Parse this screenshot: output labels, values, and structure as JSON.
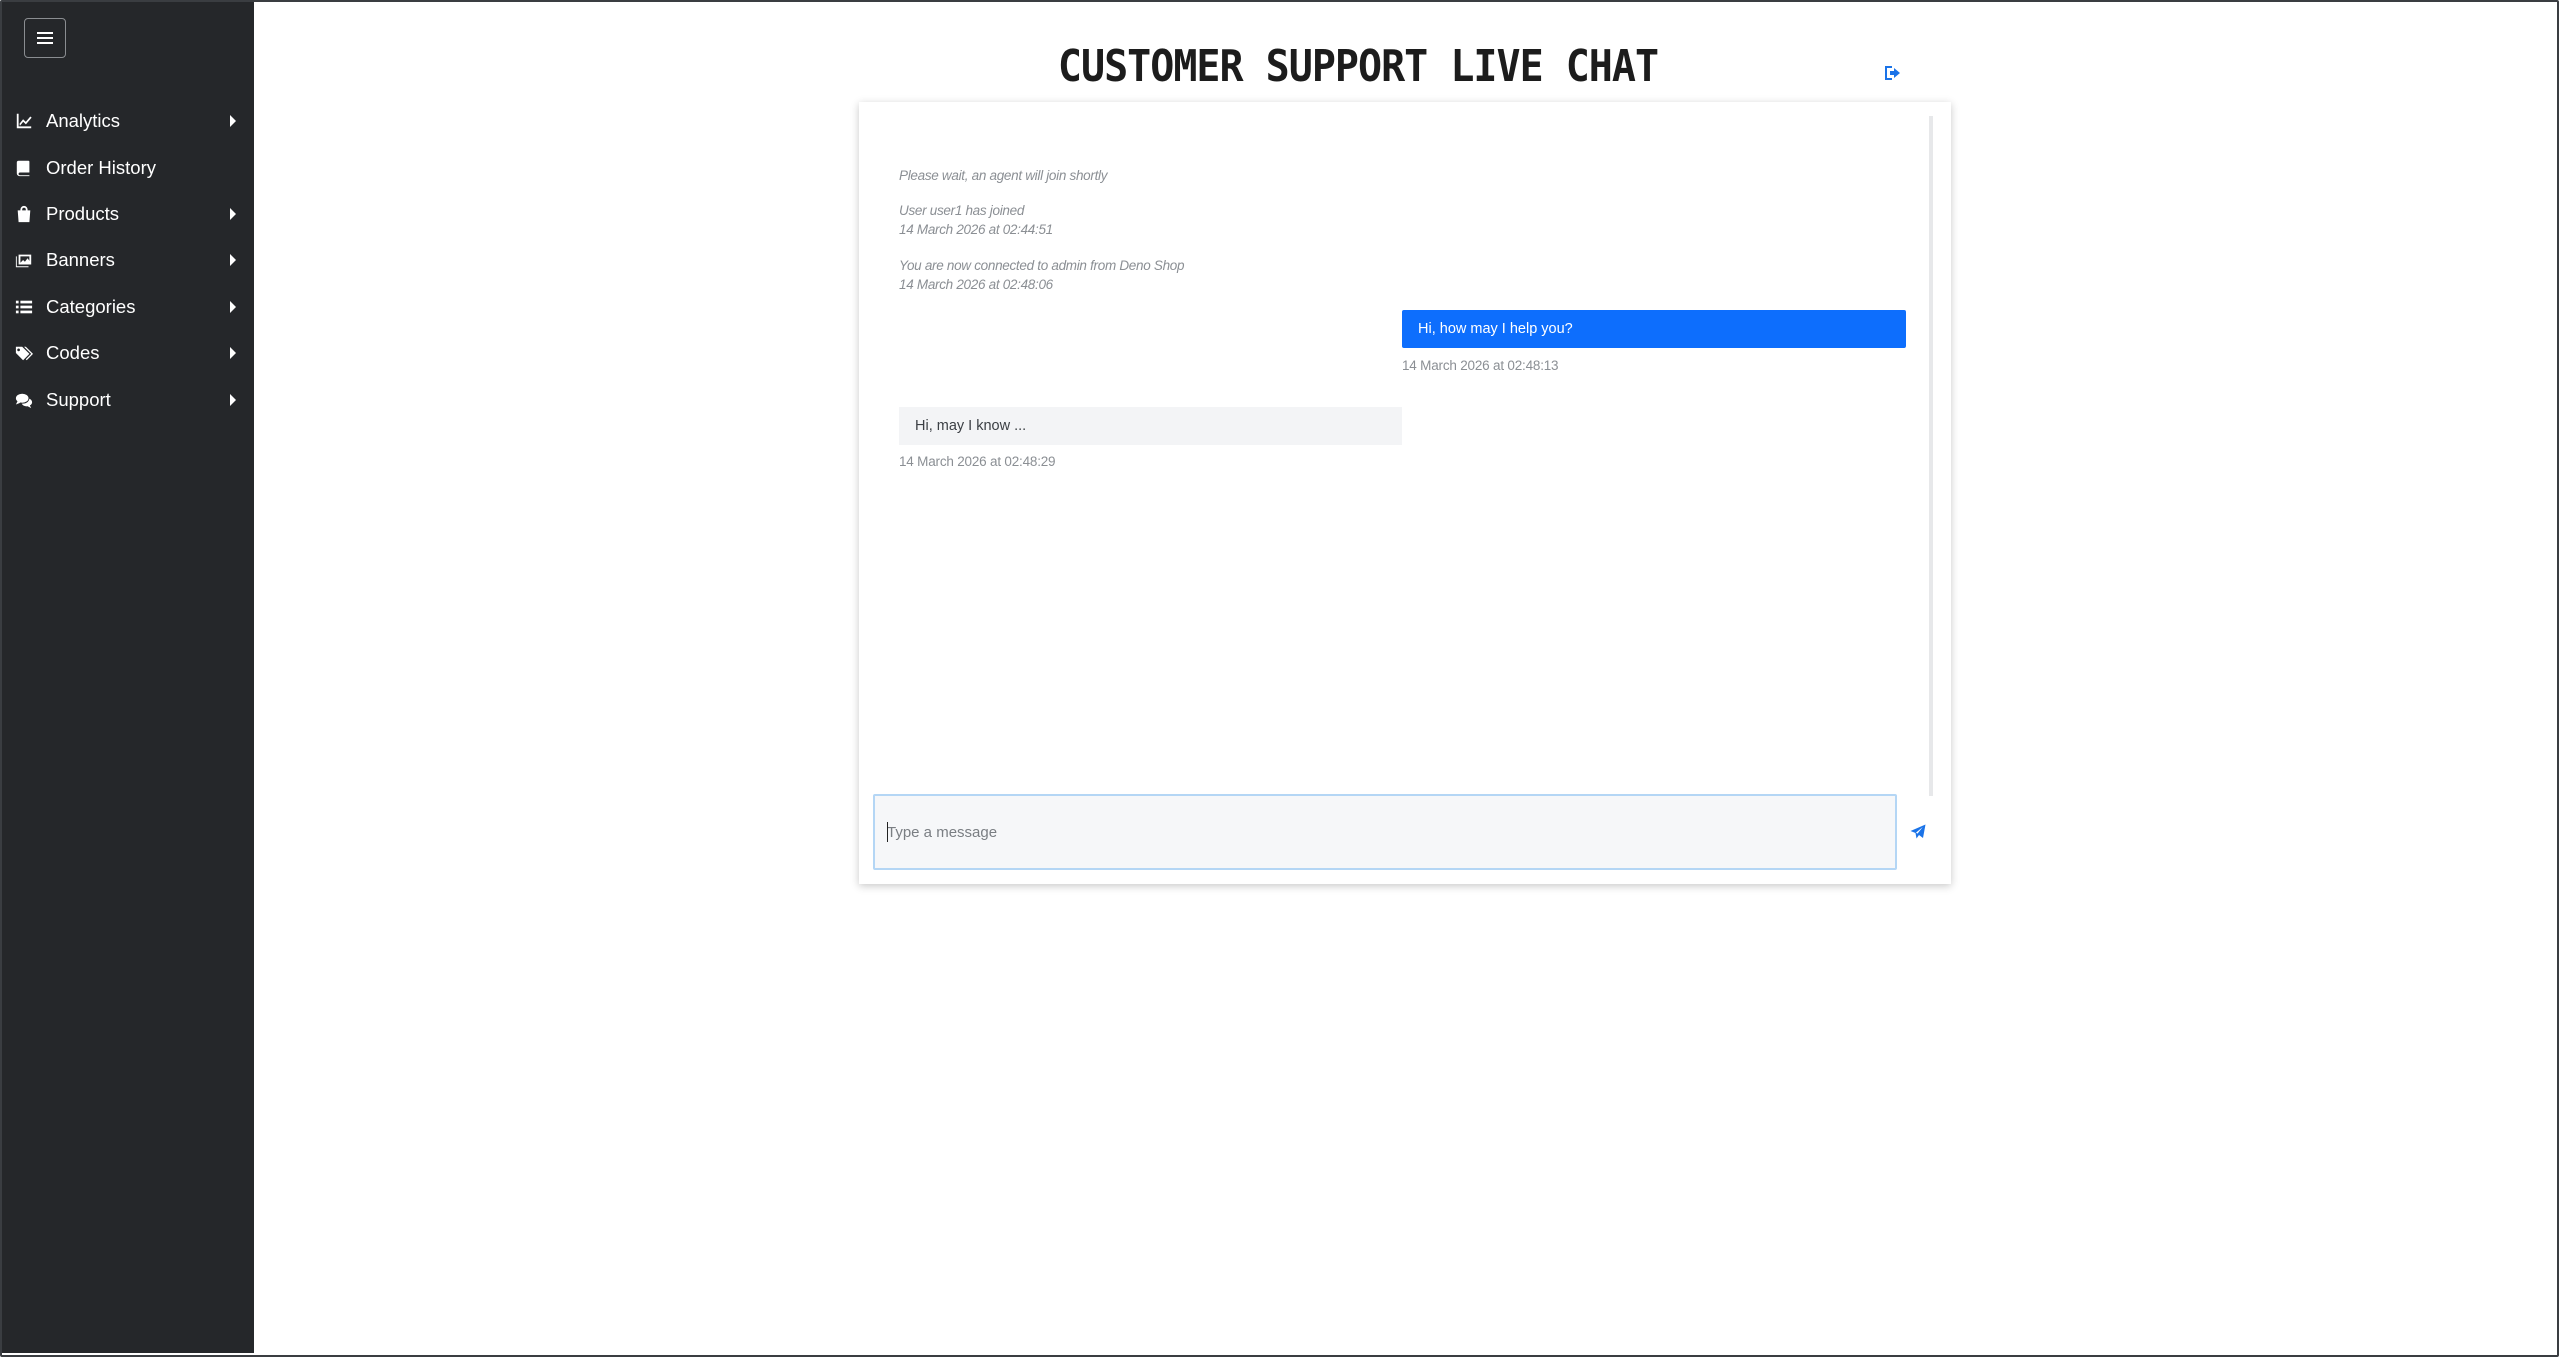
{
  "sidebar": {
    "toggle_icon": "hamburger-icon",
    "items": [
      {
        "label": "Analytics",
        "icon": "chart-line-icon",
        "has_submenu": true
      },
      {
        "label": "Order History",
        "icon": "book-icon",
        "has_submenu": false
      },
      {
        "label": "Products",
        "icon": "shopping-bag-icon",
        "has_submenu": true
      },
      {
        "label": "Banners",
        "icon": "images-icon",
        "has_submenu": true
      },
      {
        "label": "Categories",
        "icon": "list-icon",
        "has_submenu": true
      },
      {
        "label": "Codes",
        "icon": "tags-icon",
        "has_submenu": true
      },
      {
        "label": "Support",
        "icon": "comments-icon",
        "has_submenu": true
      }
    ]
  },
  "header": {
    "title": "CUSTOMER SUPPORT LIVE CHAT",
    "logout_icon": "sign-out-icon"
  },
  "chat": {
    "system_messages": [
      {
        "text": "Please wait, an agent will join shortly",
        "time": ""
      },
      {
        "text": "User user1 has joined",
        "time": "14 March 2026 at 02:44:51"
      },
      {
        "text": "You are now connected to admin from Deno Shop",
        "time": "14 March 2026 at 02:48:06"
      }
    ],
    "messages": [
      {
        "sender": "agent",
        "text": "Hi, how may I help you?",
        "time": "14 March 2026 at 02:48:13"
      },
      {
        "sender": "user",
        "text": "Hi, may I know ...",
        "time": "14 March 2026 at 02:48:29"
      }
    ],
    "input": {
      "placeholder": "Type a message",
      "value": ""
    },
    "send_icon": "paper-plane-icon"
  },
  "colors": {
    "sidebar_bg": "#25272a",
    "accent": "#0d6efd",
    "user_bubble": "#f3f4f6"
  }
}
